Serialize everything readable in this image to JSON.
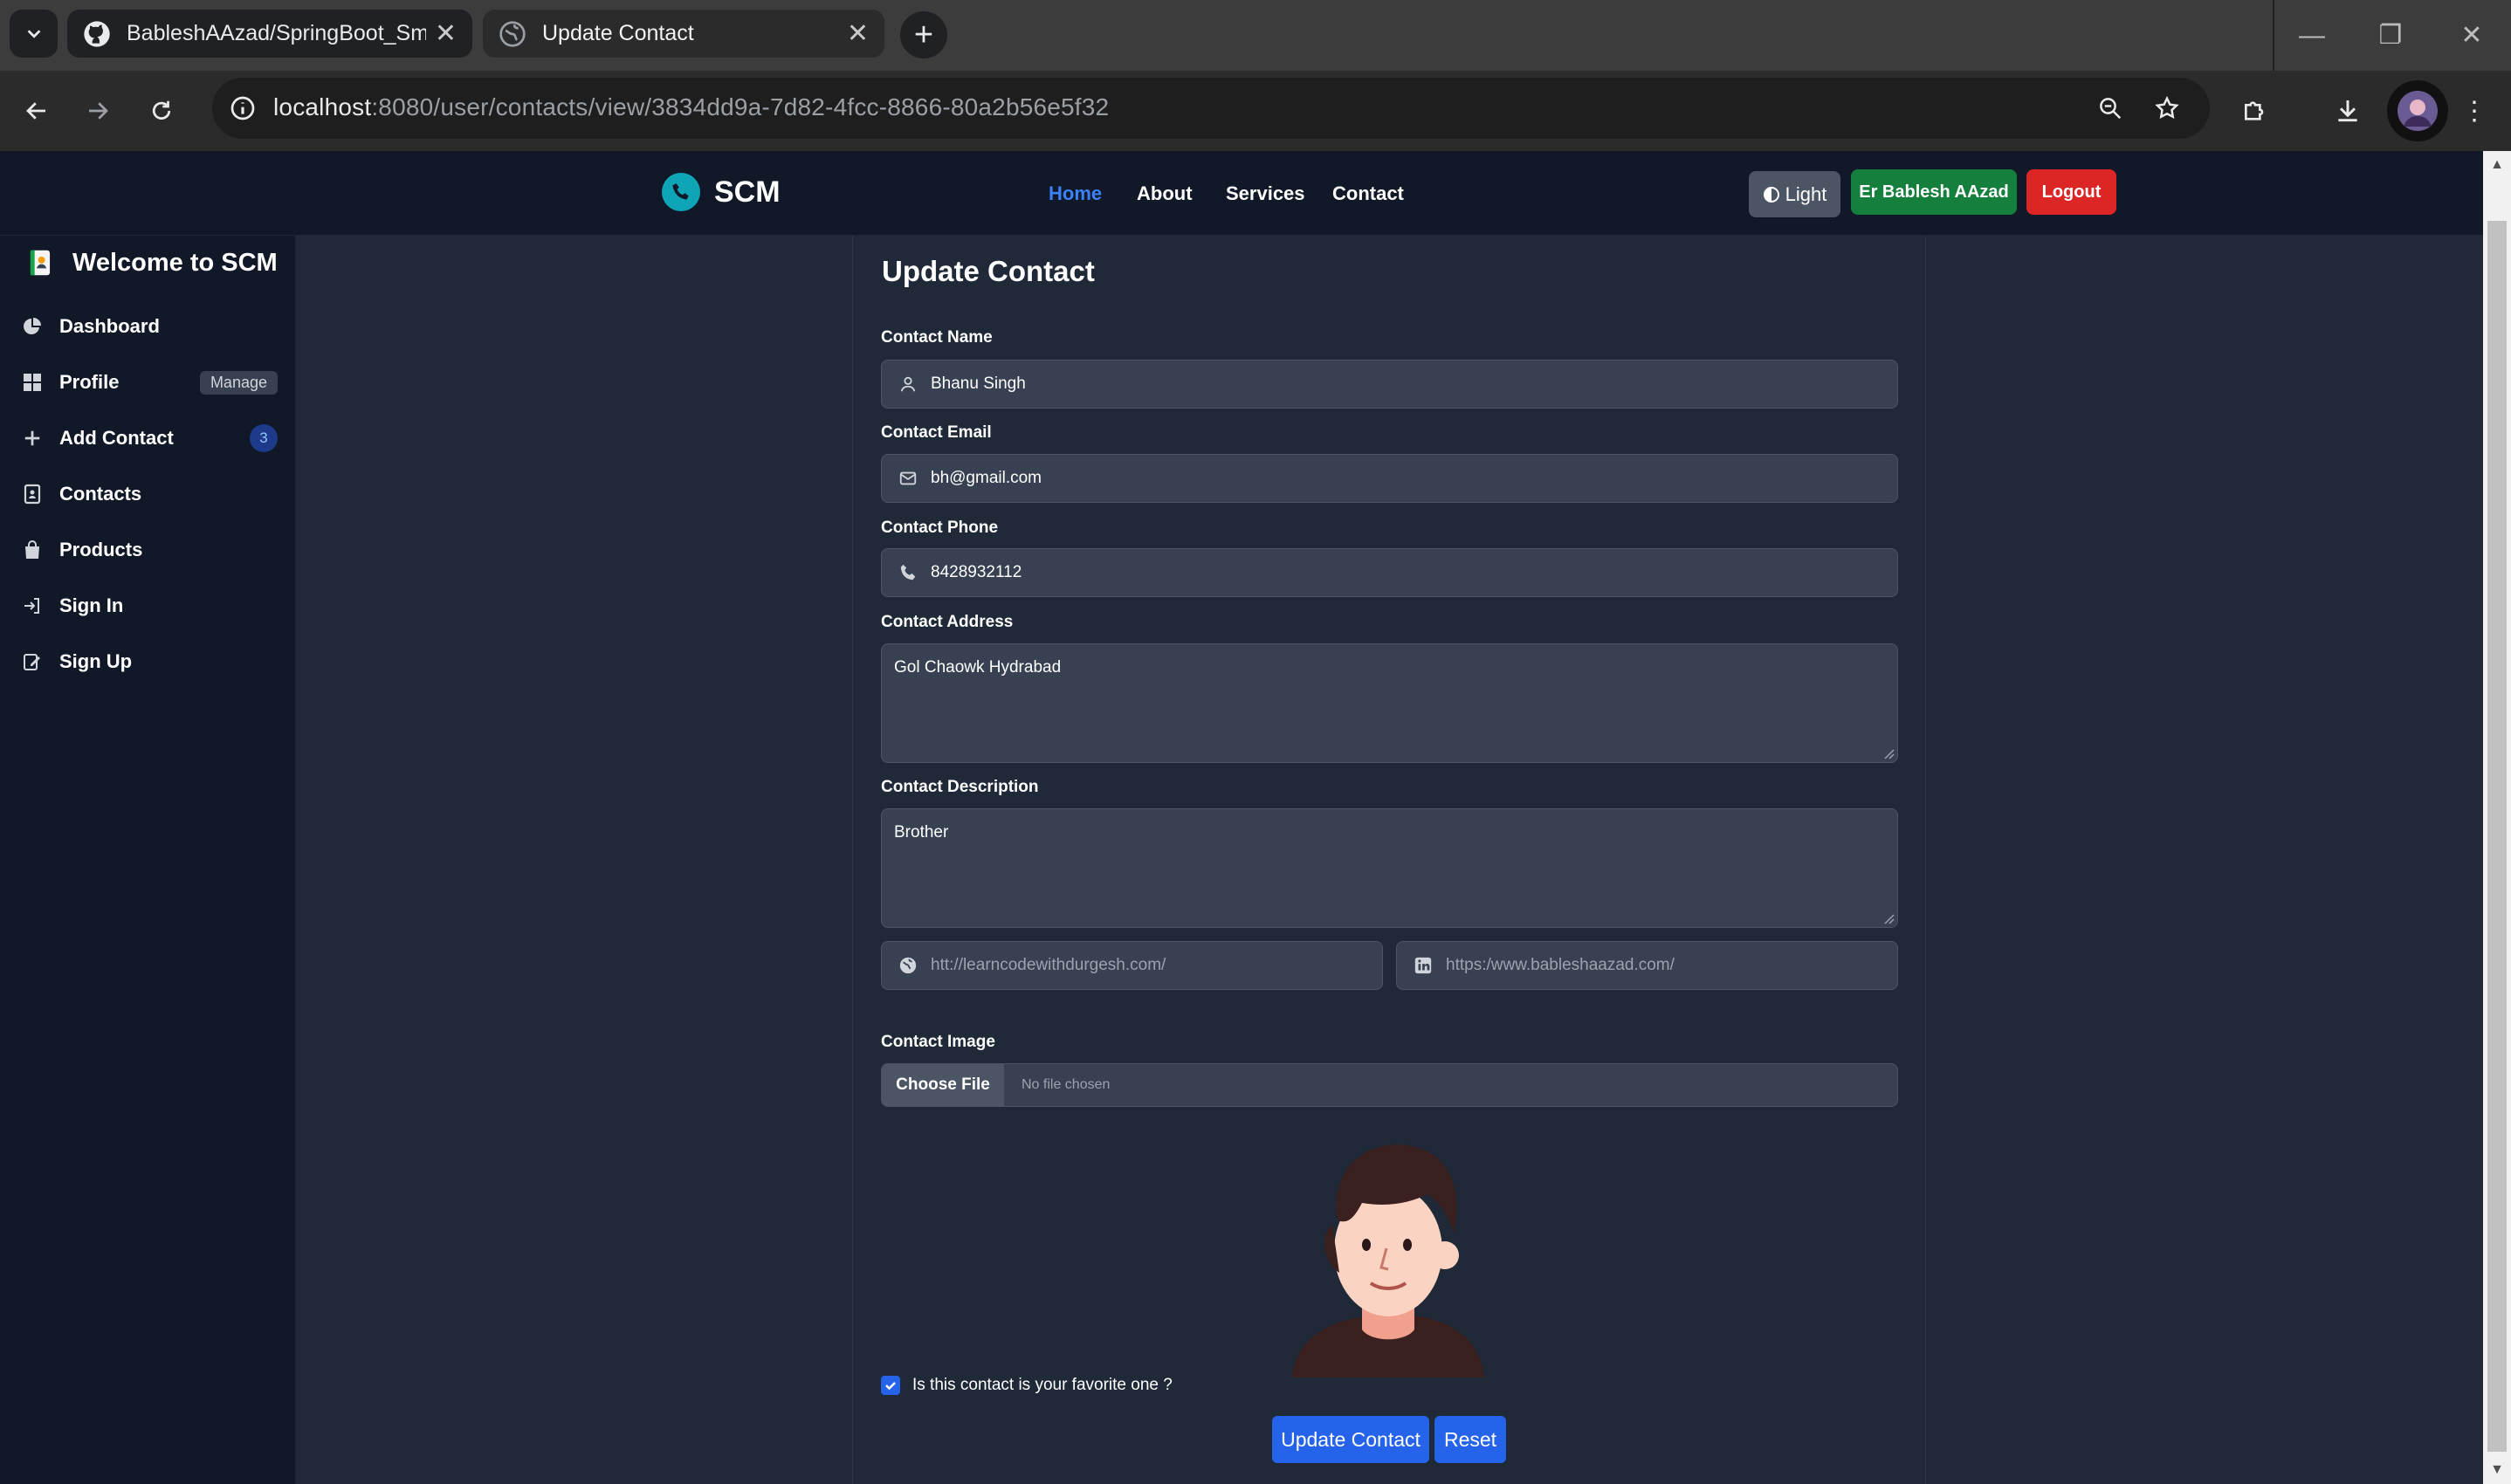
{
  "browser": {
    "tabs": [
      {
        "title": "BableshAAzad/SpringBoot_Sma",
        "icon": "github-icon"
      },
      {
        "title": "Update Contact",
        "icon": "globe-icon"
      }
    ],
    "url_host": "localhost",
    "url_path": ":8080/user/contacts/view/3834dd9a-7d82-4fcc-8866-80a2b56e5f32"
  },
  "navbar": {
    "brand": "SCM",
    "links": [
      "Home",
      "About",
      "Services",
      "Contact"
    ],
    "theme_label": "Light",
    "user_label": "Er Bablesh AAzad",
    "logout_label": "Logout"
  },
  "sidebar": {
    "title": "Welcome to SCM",
    "items": [
      {
        "label": "Dashboard",
        "icon": "pie-chart-icon"
      },
      {
        "label": "Profile",
        "icon": "grid-icon",
        "badge": "Manage"
      },
      {
        "label": "Add Contact",
        "icon": "plus-icon",
        "badge": "3"
      },
      {
        "label": "Contacts",
        "icon": "address-book-icon"
      },
      {
        "label": "Products",
        "icon": "bag-icon"
      },
      {
        "label": "Sign In",
        "icon": "sign-in-icon"
      },
      {
        "label": "Sign Up",
        "icon": "sign-up-icon"
      }
    ]
  },
  "form": {
    "title": "Update Contact",
    "name_label": "Contact Name",
    "name_value": "Bhanu Singh",
    "email_label": "Contact Email",
    "email_value": "bh@gmail.com",
    "phone_label": "Contact Phone",
    "phone_value": "8428932112",
    "address_label": "Contact Address",
    "address_value": "Gol Chaowk Hydrabad",
    "description_label": "Contact Description",
    "description_value": "Brother",
    "website_value": "htt://learncodewithdurgesh.com/",
    "linkedin_value": "https:/www.bableshaazad.com/",
    "image_label": "Contact Image",
    "choose_file_label": "Choose File",
    "no_file_label": "No file chosen",
    "favorite_label": "Is this contact is your favorite one ?",
    "favorite_checked": true,
    "update_label": "Update Contact",
    "reset_label": "Reset"
  },
  "colors": {
    "accent": "#2563eb",
    "success": "#15803d",
    "danger": "#dc2626",
    "background": "#1f2937",
    "sidebar": "#111827"
  }
}
